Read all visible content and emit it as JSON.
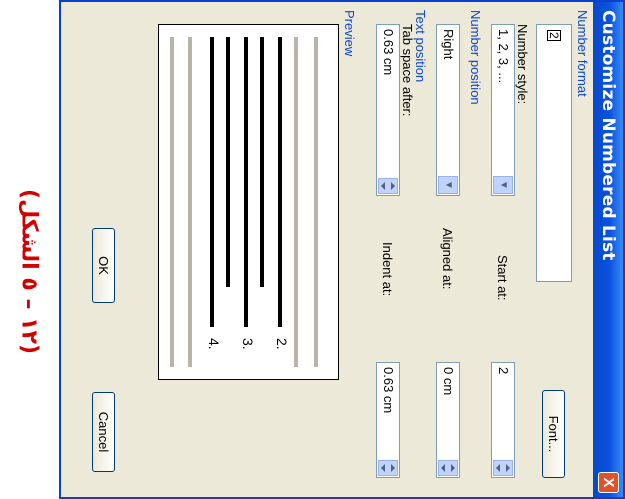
{
  "dialog": {
    "title": "Customize Numbered List",
    "close_label": "X"
  },
  "number_format": {
    "section_label": "Number format",
    "format_value": "2",
    "font_button": "Font...",
    "style_label": "Number style:",
    "style_value": "1, 2, 3, ...",
    "start_label": "Start at:",
    "start_value": "2"
  },
  "number_position": {
    "section_label": "Number position",
    "alignment_value": "Right",
    "aligned_label": "Aligned at:",
    "aligned_value": "0 cm"
  },
  "text_position": {
    "section_label": "Text position",
    "tab_label": "Tab space after:",
    "tab_value": "0.63 cm",
    "indent_label": "Indent at:",
    "indent_value": "0.63 cm"
  },
  "preview": {
    "label": "Preview",
    "numbers": [
      "2.",
      "3.",
      "4."
    ]
  },
  "buttons": {
    "ok": "OK",
    "cancel": "Cancel"
  },
  "annotation": {
    "text": "(١٢ – ٥ الشكل)",
    "color": "#d40000"
  },
  "colors": {
    "titlebar": "#0a52e0",
    "section_text": "#0a46d4",
    "dialog_bg": "#ece9d8"
  }
}
